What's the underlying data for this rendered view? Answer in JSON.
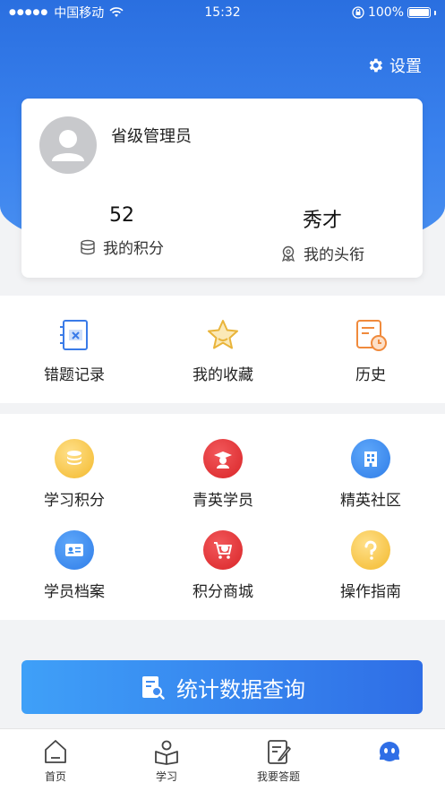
{
  "status_bar": {
    "carrier": "中国移动",
    "time": "15:32",
    "battery": "100%"
  },
  "settings": {
    "label": "设置"
  },
  "profile": {
    "name": "省级管理员",
    "points": {
      "value": "52",
      "label": "我的积分"
    },
    "title": {
      "value": "秀才",
      "label": "我的头衔"
    }
  },
  "quick_links": [
    {
      "label": "错题记录",
      "icon": "wrong-notebook-icon"
    },
    {
      "label": "我的收藏",
      "icon": "star-icon"
    },
    {
      "label": "历史",
      "icon": "history-icon"
    }
  ],
  "features": [
    {
      "label": "学习积分",
      "icon": "coins-icon",
      "color": "#f6c13b"
    },
    {
      "label": "青英学员",
      "icon": "graduate-icon",
      "color": "#e8383b"
    },
    {
      "label": "精英社区",
      "icon": "building-icon",
      "color": "#3a8ef0"
    },
    {
      "label": "学员档案",
      "icon": "id-card-icon",
      "color": "#3a8ef0"
    },
    {
      "label": "积分商城",
      "icon": "cart-icon",
      "color": "#e8383b"
    },
    {
      "label": "操作指南",
      "icon": "question-icon",
      "color": "#f6c13b"
    }
  ],
  "query_button": {
    "label": "统计数据查询"
  },
  "tabbar": [
    {
      "label": "首页",
      "icon": "home-icon"
    },
    {
      "label": "学习",
      "icon": "study-icon"
    },
    {
      "label": "我要答题",
      "icon": "answer-icon"
    },
    {
      "label": "",
      "icon": "profile-icon"
    }
  ],
  "colors": {
    "primary": "#2f6ee6",
    "red": "#e8383b",
    "yellow": "#f6c13b",
    "orange": "#f08a3c"
  }
}
